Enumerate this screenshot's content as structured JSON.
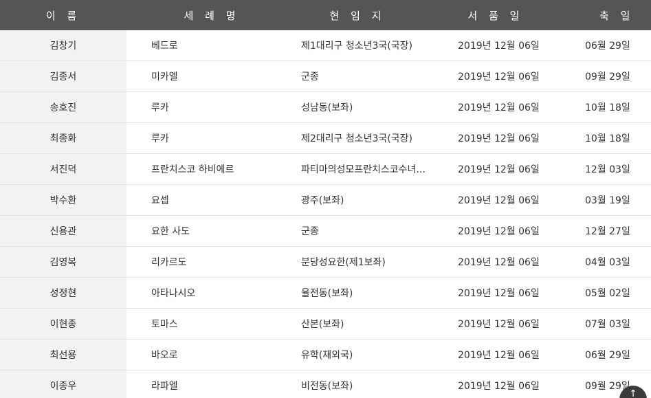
{
  "table": {
    "headers": {
      "name": "이 름",
      "baptismal_name": "세 례 명",
      "current_post": "현 임 지",
      "ordination_date": "서 품 일",
      "feast_day": "축 일"
    },
    "rows": [
      {
        "name": "김창기",
        "baptismal_name": "베드로",
        "current_post": "제1대리구 청소년3국(국장)",
        "ordination_date": "2019년 12월 06일",
        "feast_day": "06월 29일"
      },
      {
        "name": "김종서",
        "baptismal_name": "미카엘",
        "current_post": "군종",
        "ordination_date": "2019년 12월 06일",
        "feast_day": "09월 29일"
      },
      {
        "name": "송호진",
        "baptismal_name": "루카",
        "current_post": "성남동(보좌)",
        "ordination_date": "2019년 12월 06일",
        "feast_day": "10월 18일"
      },
      {
        "name": "최종화",
        "baptismal_name": "루카",
        "current_post": "제2대리구 청소년3국(국장)",
        "ordination_date": "2019년 12월 06일",
        "feast_day": "10월 18일"
      },
      {
        "name": "서진덕",
        "baptismal_name": "프란치스코 하비에르",
        "current_post": "파티마의성모프란치스코수녀...",
        "ordination_date": "2019년 12월 06일",
        "feast_day": "12월 03일"
      },
      {
        "name": "박수환",
        "baptismal_name": "요셉",
        "current_post": "광주(보좌)",
        "ordination_date": "2019년 12월 06일",
        "feast_day": "03월 19일"
      },
      {
        "name": "신용관",
        "baptismal_name": "요한 사도",
        "current_post": "군종",
        "ordination_date": "2019년 12월 06일",
        "feast_day": "12월 27일"
      },
      {
        "name": "김영복",
        "baptismal_name": "리카르도",
        "current_post": "분당성요한(제1보좌)",
        "ordination_date": "2019년 12월 06일",
        "feast_day": "04월 03일"
      },
      {
        "name": "성정현",
        "baptismal_name": "아타나시오",
        "current_post": "율전동(보좌)",
        "ordination_date": "2019년 12월 06일",
        "feast_day": "05월 02일"
      },
      {
        "name": "이현종",
        "baptismal_name": "토마스",
        "current_post": "산본(보좌)",
        "ordination_date": "2019년 12월 06일",
        "feast_day": "07월 03일"
      },
      {
        "name": "최선용",
        "baptismal_name": "바오로",
        "current_post": "유학(재외국)",
        "ordination_date": "2019년 12월 06일",
        "feast_day": "06월 29일"
      },
      {
        "name": "이종우",
        "baptismal_name": "라파엘",
        "current_post": "비전동(보좌)",
        "ordination_date": "2019년 12월 06일",
        "feast_day": "09월 29일"
      }
    ]
  },
  "scroll_top": {
    "icon": "arrow-up-icon",
    "glyph": "↑"
  }
}
